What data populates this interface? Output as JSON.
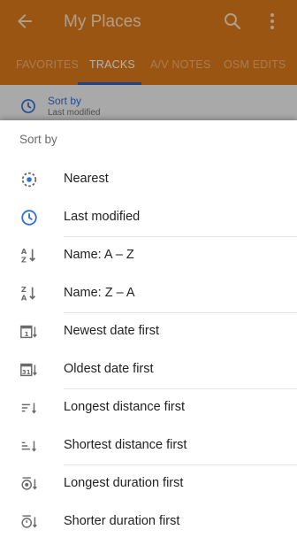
{
  "appbar": {
    "title": "My Places",
    "tabs": [
      "FAVORITES",
      "TRACKS",
      "A/V NOTES",
      "OSM EDITS"
    ],
    "active_tab": "TRACKS",
    "color": "#de7a1a"
  },
  "background_sort": {
    "label": "Sort by",
    "value": "Last modified"
  },
  "sheet": {
    "title": "Sort by",
    "options": [
      {
        "label": "Nearest",
        "icon": "nearest-icon"
      },
      {
        "label": "Last modified",
        "icon": "clock-icon",
        "selected": true
      },
      {
        "label": "Name: A – Z",
        "icon": "sort-a-z-icon"
      },
      {
        "label": "Name: Z – A",
        "icon": "sort-z-a-icon"
      },
      {
        "label": "Newest date first",
        "icon": "calendar-1-icon"
      },
      {
        "label": "Oldest date first",
        "icon": "calendar-31-icon"
      },
      {
        "label": "Longest distance first",
        "icon": "distance-desc-icon"
      },
      {
        "label": "Shortest distance first",
        "icon": "distance-asc-icon"
      },
      {
        "label": "Longest duration first",
        "icon": "duration-desc-icon"
      },
      {
        "label": "Shorter duration first",
        "icon": "duration-asc-icon"
      }
    ]
  },
  "colors": {
    "accent_blue": "#2f6fd6",
    "icon_gray": "#6b6b6b"
  }
}
